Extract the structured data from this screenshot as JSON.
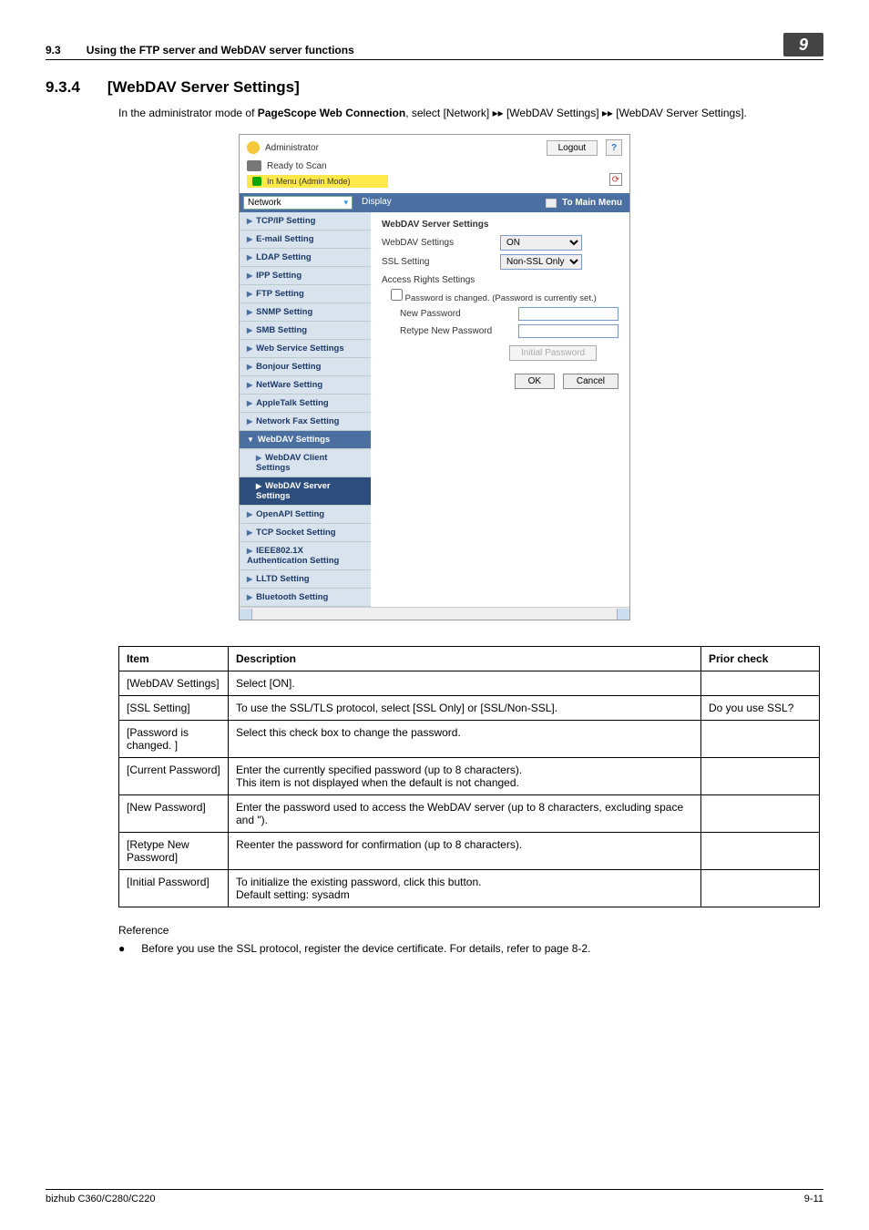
{
  "run_head": {
    "section_no": "9.3",
    "section_title": "Using the FTP server and WebDAV server functions",
    "chapter_badge": "9"
  },
  "heading": {
    "num": "9.3.4",
    "title": "[WebDAV Server Settings]"
  },
  "intro": {
    "pre": "In the administrator mode of ",
    "bold": "PageScope Web Connection",
    "post": ", select [Network] ▸▸ [WebDAV Settings] ▸▸ [WebDAV Server Settings]."
  },
  "shot": {
    "admin_label": "Administrator",
    "logout": "Logout",
    "help": "?",
    "ready": "Ready to Scan",
    "status_bar": "In Menu (Admin Mode)",
    "dropdown": "Network",
    "display": "Display",
    "to_main": "To Main Menu",
    "side_items": [
      {
        "label": "TCP/IP Setting",
        "kind": "itm"
      },
      {
        "label": "E-mail Setting",
        "kind": "itm"
      },
      {
        "label": "LDAP Setting",
        "kind": "itm"
      },
      {
        "label": "IPP Setting",
        "kind": "itm"
      },
      {
        "label": "FTP Setting",
        "kind": "itm"
      },
      {
        "label": "SNMP Setting",
        "kind": "itm"
      },
      {
        "label": "SMB Setting",
        "kind": "itm"
      },
      {
        "label": "Web Service Settings",
        "kind": "itm"
      },
      {
        "label": "Bonjour Setting",
        "kind": "itm"
      },
      {
        "label": "NetWare Setting",
        "kind": "itm"
      },
      {
        "label": "AppleTalk Setting",
        "kind": "itm"
      },
      {
        "label": "Network Fax Setting",
        "kind": "itm"
      },
      {
        "label": "WebDAV Settings",
        "kind": "open"
      },
      {
        "label": "WebDAV Client Settings",
        "kind": "sub"
      },
      {
        "label": "WebDAV Server Settings",
        "kind": "sub active"
      },
      {
        "label": "OpenAPI Setting",
        "kind": "itm"
      },
      {
        "label": "TCP Socket Setting",
        "kind": "itm"
      },
      {
        "label": "IEEE802.1X Authentication Setting",
        "kind": "itm"
      },
      {
        "label": "LLTD Setting",
        "kind": "itm"
      },
      {
        "label": "Bluetooth Setting",
        "kind": "itm"
      }
    ],
    "panel_title": "WebDAV Server Settings",
    "row_webdav_label": "WebDAV Settings",
    "row_webdav_value": "ON",
    "row_ssl_label": "SSL Setting",
    "row_ssl_value": "Non-SSL Only",
    "access_rights": "Access Rights Settings",
    "pw_changed": "Password is changed. (Password is currently set.)",
    "new_pw": "New Password",
    "retype_pw": "Retype New Password",
    "init_pw": "Initial Password",
    "ok": "OK",
    "cancel": "Cancel"
  },
  "table": {
    "headers": [
      "Item",
      "Description",
      "Prior check"
    ],
    "rows": [
      {
        "item": "[WebDAV Settings]",
        "desc": "Select [ON].",
        "check": ""
      },
      {
        "item": "[SSL Setting]",
        "desc": "To use the SSL/TLS protocol, select [SSL Only] or [SSL/Non-SSL].",
        "check": "Do you use SSL?"
      },
      {
        "item": "[Password is changed. ]",
        "desc": "Select this check box to change the password.",
        "check": ""
      },
      {
        "item": "[Current Password]",
        "desc": "Enter the currently specified password (up to 8 characters).\nThis item is not displayed when the default is not changed.",
        "check": ""
      },
      {
        "item": "[New Password]",
        "desc": "Enter the password used to access the WebDAV server (up to 8 characters, excluding space and \").",
        "check": ""
      },
      {
        "item": "[Retype New Password]",
        "desc": "Reenter the password for confirmation (up to 8 characters).",
        "check": ""
      },
      {
        "item": "[Initial Password]",
        "desc": "To initialize the existing password, click this button.\nDefault setting: sysadm",
        "check": ""
      }
    ]
  },
  "reference": {
    "heading": "Reference",
    "bullet": "Before you use the SSL protocol, register the device certificate. For details, refer to page 8-2."
  },
  "footer": {
    "model": "bizhub C360/C280/C220",
    "page": "9-11"
  }
}
